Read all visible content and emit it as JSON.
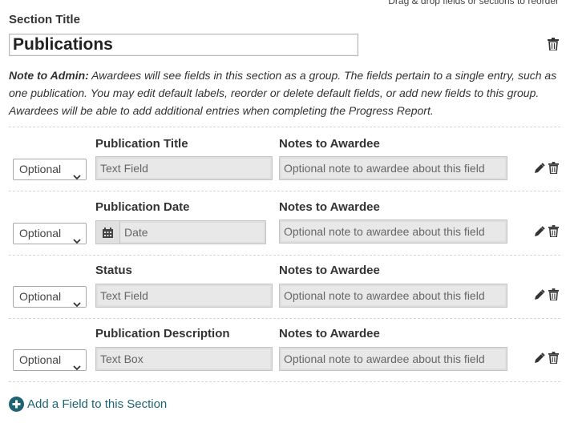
{
  "drag_hint": "Drag & drop fields or sections to reorder",
  "section": {
    "label": "Section Title",
    "title_value": "Publications"
  },
  "note": {
    "prefix": "Note to Admin:",
    "text": " Awardees will see fields in this section as a group. The fields pertain to a single entry, such as one publication. You may edit default labels, reorder or delete default fields, or add new fields to this group. Awardees will be able to add additional entries when completing the Progress Report."
  },
  "fields": [
    {
      "label": "Publication Title",
      "notes_label": "Notes to Awardee",
      "requirement": "Optional",
      "field_type": "Text Field",
      "note_placeholder": "Optional note to awardee about this field"
    },
    {
      "label": "Publication Date",
      "notes_label": "Notes to Awardee",
      "requirement": "Optional",
      "field_type": "Date",
      "note_placeholder": "Optional note to awardee about this field"
    },
    {
      "label": "Status",
      "notes_label": "Notes to Awardee",
      "requirement": "Optional",
      "field_type": "Text Field",
      "note_placeholder": "Optional note to awardee about this field"
    },
    {
      "label": "Publication Description",
      "notes_label": "Notes to Awardee",
      "requirement": "Optional",
      "field_type": "Text Box",
      "note_placeholder": "Optional note to awardee about this field"
    }
  ],
  "add_field_label": "Add a Field to this Section",
  "icons": {
    "trash": "trash-icon",
    "edit": "pencil-icon",
    "calendar": "calendar-icon",
    "chevron": "chevron-down-icon",
    "add": "plus-circle-icon"
  },
  "colors": {
    "accent": "#1d6473",
    "field_bg": "#e8e8e8"
  }
}
